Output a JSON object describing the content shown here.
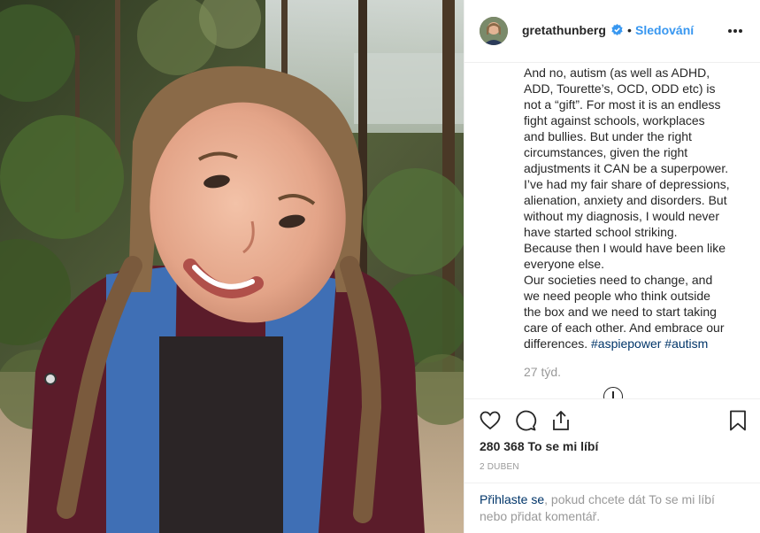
{
  "post": {
    "image_alt": "Smiling girl with braided hair in a blue hooded jacket among trees"
  },
  "header": {
    "username": "gretathunberg",
    "separator": "•",
    "follow_label": "Sledování",
    "verified_icon": "verified-badge-icon",
    "more_icon": "more-options-icon"
  },
  "caption": {
    "lines": [
      "And no, autism (as well as ADHD,",
      "ADD, Tourette’s, OCD, ODD etc) is",
      "not a “gift”. For most it is an endless",
      "fight against schools, workplaces",
      "and bullies. But under the right",
      "circumstances, given the right",
      "adjustments it CAN be a superpower.",
      "I’ve had my fair share of depressions,",
      "alienation, anxiety and disorders. But",
      "without my diagnosis, I would never",
      "have started school striking.",
      "Because then I would have been like",
      "everyone else.",
      "Our societies need to change, and",
      "we need people who think outside",
      "the box and we need to start taking",
      "care of each other. And embrace our"
    ],
    "last_line_text": "differences. ",
    "hashtag_1": "#aspiepower",
    "hashtag_2": "#autism",
    "time_ago": "27 týd."
  },
  "actions": {
    "like_icon": "heart-icon",
    "comment_icon": "comment-icon",
    "share_icon": "share-icon",
    "save_icon": "bookmark-icon"
  },
  "likes": {
    "count": "280 368",
    "label": "To se mi líbí"
  },
  "date": "2 DUBEN",
  "login": {
    "link": "Přihlaste se",
    "text": ", pokud chcete dát To se mi líbí",
    "text2": "nebo přidat komentář."
  },
  "colors": {
    "link_blue": "#3897f0",
    "hashtag": "#003569",
    "muted": "#999999",
    "text": "#262626",
    "border": "#efefef"
  }
}
